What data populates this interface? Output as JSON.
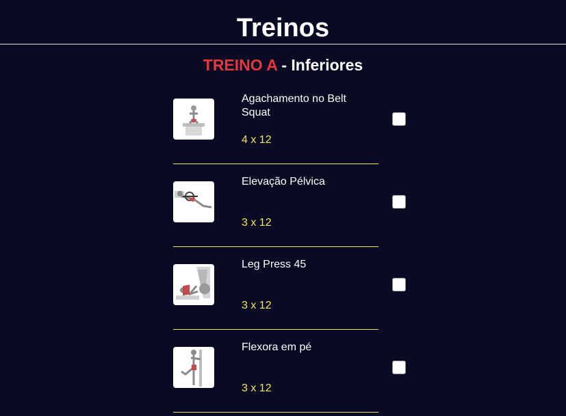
{
  "header": {
    "title": "Treinos"
  },
  "workout": {
    "label": "TREINO A",
    "separator": " - ",
    "focus": "Inferiores"
  },
  "exercises": [
    {
      "name": "Agachamento no Belt Squat",
      "sets": "4 x 12",
      "image_icon": "belt-squat-illustration",
      "checked": false
    },
    {
      "name": "Elevação Pélvica",
      "sets": "3 x 12",
      "image_icon": "hip-thrust-illustration",
      "checked": false
    },
    {
      "name": "Leg Press 45",
      "sets": "3 x 12",
      "image_icon": "leg-press-illustration",
      "checked": false
    },
    {
      "name": "Flexora em pé",
      "sets": "3 x 12",
      "image_icon": "standing-leg-curl-illustration",
      "checked": false
    }
  ],
  "colors": {
    "background": "#0a0a24",
    "accent_red": "#e8363a",
    "accent_yellow": "#f2e94b",
    "text": "#ffffff"
  }
}
